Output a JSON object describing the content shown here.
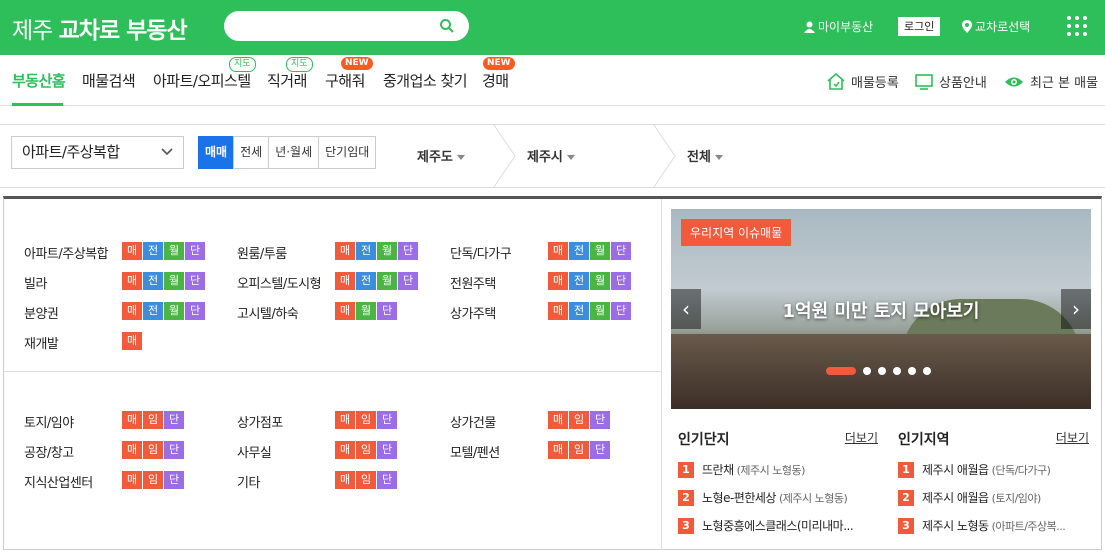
{
  "header": {
    "logo_part1": "제주",
    "logo_part2": "교차로 부동산",
    "search_placeholder": "",
    "my_realty": "마이부동산",
    "login": "로그인",
    "select_region": "교차로선택"
  },
  "nav": {
    "items": [
      {
        "label": "부동산홈",
        "active": true
      },
      {
        "label": "매물검색"
      },
      {
        "label": "아파트/오피스텔",
        "badge": "지도"
      },
      {
        "label": "직거래",
        "badge": "지도"
      },
      {
        "label": "구해줘",
        "badge": "NEW"
      },
      {
        "label": "중개업소 찾기"
      },
      {
        "label": "경매",
        "badge": "NEW"
      }
    ],
    "right": [
      {
        "label": "매물등록",
        "icon": "house-icon"
      },
      {
        "label": "상품안내",
        "icon": "monitor-icon"
      },
      {
        "label": "최근 본 매물",
        "icon": "eye-icon"
      }
    ]
  },
  "filter": {
    "property_type": "아파트/주상복합",
    "deal_tabs": [
      "매매",
      "전세",
      "년·월세",
      "단기임대"
    ],
    "active_deal": "매매",
    "regions": [
      "제주도",
      "제주시",
      "전체"
    ]
  },
  "categories": {
    "residential": [
      {
        "label": "아파트/주상복합",
        "tags": [
          "매",
          "전",
          "월",
          "단"
        ]
      },
      {
        "label": "원룸/투룸",
        "tags": [
          "매",
          "전",
          "월",
          "단"
        ]
      },
      {
        "label": "단독/다가구",
        "tags": [
          "매",
          "전",
          "월",
          "단"
        ]
      },
      {
        "label": "빌라",
        "tags": [
          "매",
          "전",
          "월",
          "단"
        ]
      },
      {
        "label": "오피스텔/도시형",
        "tags": [
          "매",
          "전",
          "월",
          "단"
        ]
      },
      {
        "label": "전원주택",
        "tags": [
          "매",
          "전",
          "월",
          "단"
        ]
      },
      {
        "label": "분양권",
        "tags": [
          "매",
          "전",
          "월",
          "단"
        ]
      },
      {
        "label": "고시텔/하숙",
        "tags": [
          "매",
          "월",
          "단"
        ]
      },
      {
        "label": "상가주택",
        "tags": [
          "매",
          "전",
          "월",
          "단"
        ]
      },
      {
        "label": "재개발",
        "tags": [
          "매"
        ]
      }
    ],
    "commercial": [
      {
        "label": "토지/임야",
        "tags": [
          "매",
          "임",
          "단"
        ]
      },
      {
        "label": "상가점포",
        "tags": [
          "매",
          "임",
          "단"
        ]
      },
      {
        "label": "상가건물",
        "tags": [
          "매",
          "임",
          "단"
        ]
      },
      {
        "label": "공장/창고",
        "tags": [
          "매",
          "임",
          "단"
        ]
      },
      {
        "label": "사무실",
        "tags": [
          "매",
          "임",
          "단"
        ]
      },
      {
        "label": "모텔/펜션",
        "tags": [
          "매",
          "임",
          "단"
        ]
      },
      {
        "label": "지식산업센터",
        "tags": [
          "매",
          "임",
          "단"
        ]
      },
      {
        "label": "기타",
        "tags": [
          "매",
          "임",
          "단"
        ]
      }
    ]
  },
  "banner": {
    "tag": "우리지역 이슈매물",
    "title": "1억원 미만 토지 모아보기",
    "prev": "‹",
    "next": "›",
    "slide_count": 6,
    "active_slide": 1
  },
  "popular_complex": {
    "title": "인기단지",
    "more": "더보기",
    "items": [
      {
        "rank": "1",
        "name": "뜨란채",
        "sub": "(제주시 노형동)"
      },
      {
        "rank": "2",
        "name": "노형e-편한세상",
        "sub": "(제주시 노형동)"
      },
      {
        "rank": "3",
        "name": "노형중흥에스클래스(미리내마...",
        "sub": ""
      }
    ]
  },
  "popular_region": {
    "title": "인기지역",
    "more": "더보기",
    "items": [
      {
        "rank": "1",
        "name": "제주시 애월읍",
        "sub": "(단독/다가구)"
      },
      {
        "rank": "2",
        "name": "제주시 애월읍",
        "sub": "(토지/임야)"
      },
      {
        "rank": "3",
        "name": "제주시 노형동",
        "sub": "(아파트/주상복..."
      }
    ]
  },
  "colors": {
    "brand": "#2ebe5a",
    "tag_mae": "#f15a3a",
    "tag_jeon": "#3c8dde",
    "tag_wol": "#4bb543",
    "tag_dan": "#9b6ee8",
    "active_tab": "#1a73e8"
  }
}
